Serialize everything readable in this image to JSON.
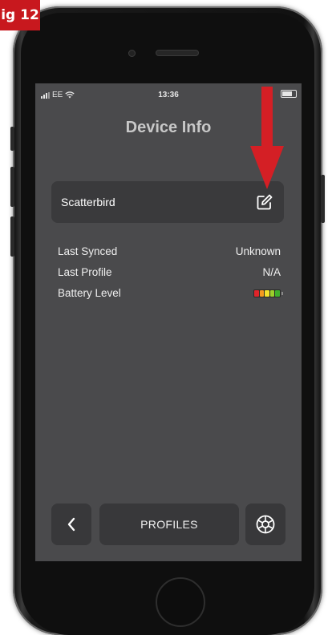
{
  "figure": {
    "label": "ig 12"
  },
  "status_bar": {
    "carrier": "EE",
    "time": "13:36"
  },
  "header": {
    "title": "Device Info"
  },
  "device": {
    "name": "Scatterbird"
  },
  "info_rows": [
    {
      "label": "Last Synced",
      "value": "Unknown"
    },
    {
      "label": "Last Profile",
      "value": "N/A"
    },
    {
      "label": "Battery Level",
      "value": ""
    }
  ],
  "battery": {
    "level": 1.0,
    "segment_colors": [
      "#e0242a",
      "#f59a1f",
      "#f2e22c",
      "#9ccf2a",
      "#3fb02c"
    ]
  },
  "footer": {
    "profiles_label": "PROFILES"
  },
  "colors": {
    "annotation_arrow": "#d41f25",
    "screen_background": "#4a4a4c",
    "card_background": "#3a3a3c"
  }
}
